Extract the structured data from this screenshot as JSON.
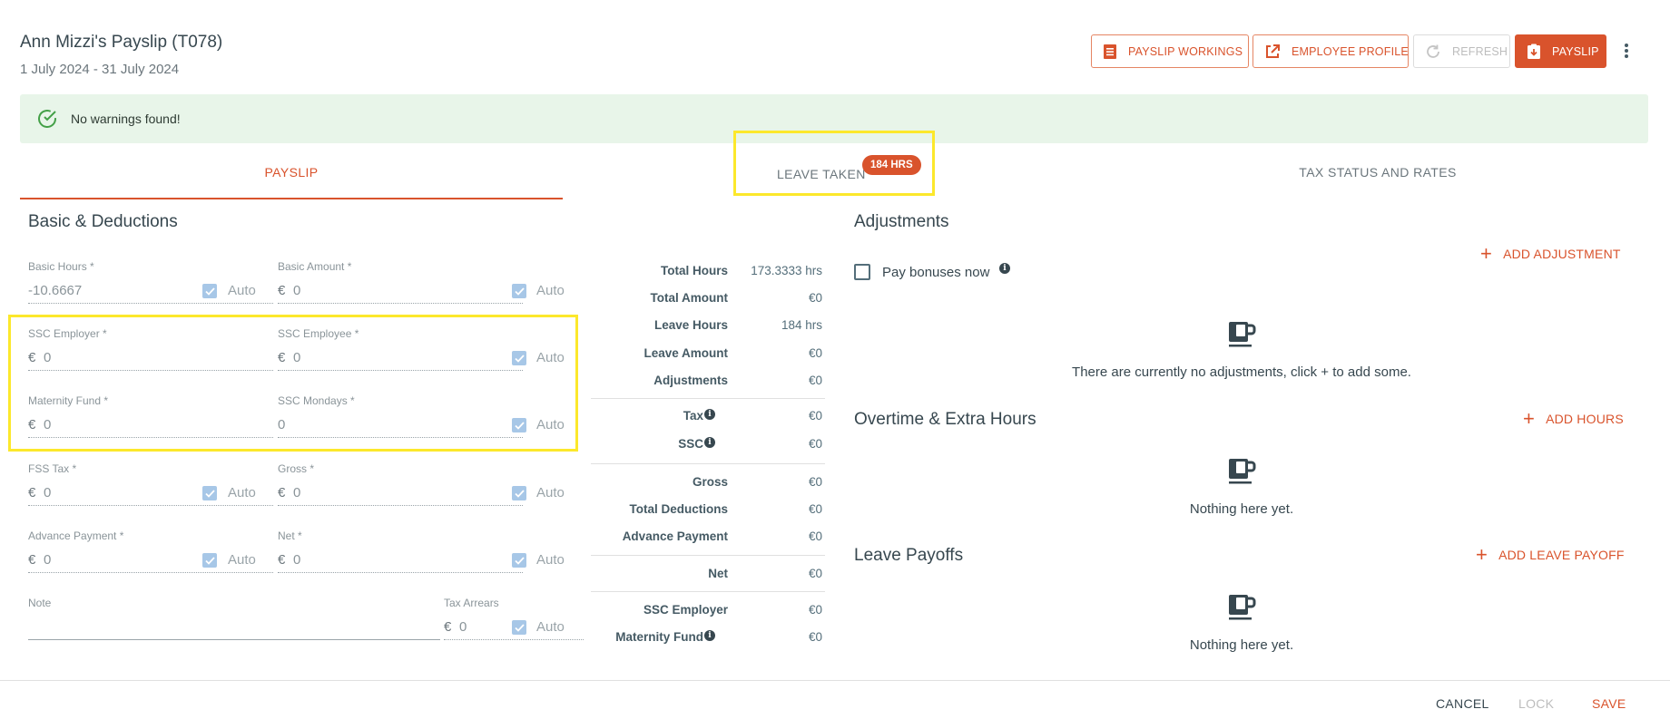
{
  "header": {
    "title": "Ann Mizzi's Payslip (T078)",
    "period": "1 July 2024 - 31 July 2024",
    "buttons": {
      "payslip_workings": "PAYSLIP WORKINGS",
      "employee_profile": "EMPLOYEE PROFILE",
      "refresh": "REFRESH",
      "payslip": "PAYSLIP"
    }
  },
  "alert": {
    "text": "No warnings found!"
  },
  "tabs": {
    "payslip": "PAYSLIP",
    "leave_taken": "LEAVE TAKEN",
    "leave_badge": "184 HRS",
    "tax_status": "TAX STATUS AND RATES"
  },
  "basic": {
    "heading": "Basic & Deductions",
    "auto_label": "Auto",
    "currency": "€",
    "fields": {
      "basic_hours": {
        "label": "Basic Hours *",
        "value": "-10.6667"
      },
      "basic_amount": {
        "label": "Basic Amount *",
        "value": "0"
      },
      "ssc_employer": {
        "label": "SSC Employer *",
        "value": "0"
      },
      "ssc_employee": {
        "label": "SSC Employee *",
        "value": "0"
      },
      "maternity_fund": {
        "label": "Maternity Fund *",
        "value": "0"
      },
      "ssc_mondays": {
        "label": "SSC Mondays *",
        "value": "0"
      },
      "fss_tax": {
        "label": "FSS Tax *",
        "value": "0"
      },
      "gross": {
        "label": "Gross *",
        "value": "0"
      },
      "advance_payment": {
        "label": "Advance Payment *",
        "value": "0"
      },
      "net": {
        "label": "Net *",
        "value": "0"
      },
      "note": {
        "label": "Note",
        "value": ""
      },
      "tax_arrears": {
        "label": "Tax Arrears",
        "value": "0"
      }
    }
  },
  "summary": {
    "total_hours": {
      "label": "Total Hours",
      "value": "173.3333 hrs"
    },
    "total_amount": {
      "label": "Total Amount",
      "value": "€0"
    },
    "leave_hours": {
      "label": "Leave Hours",
      "value": "184 hrs"
    },
    "leave_amount": {
      "label": "Leave Amount",
      "value": "€0"
    },
    "adjustments": {
      "label": "Adjustments",
      "value": "€0"
    },
    "tax": {
      "label": "Tax",
      "value": "€0"
    },
    "ssc": {
      "label": "SSC",
      "value": "€0"
    },
    "gross": {
      "label": "Gross",
      "value": "€0"
    },
    "total_deductions": {
      "label": "Total Deductions",
      "value": "€0"
    },
    "advance_payment": {
      "label": "Advance Payment",
      "value": "€0"
    },
    "net": {
      "label": "Net",
      "value": "€0"
    },
    "ssc_employer": {
      "label": "SSC Employer",
      "value": "€0"
    },
    "maternity_fund": {
      "label": "Maternity Fund",
      "value": "€0"
    }
  },
  "adjustments": {
    "heading": "Adjustments",
    "add_label": "ADD ADJUSTMENT",
    "pay_bonuses_label": "Pay bonuses now",
    "empty_text": "There are currently no adjustments, click + to add some."
  },
  "overtime": {
    "heading": "Overtime & Extra Hours",
    "add_label": "ADD HOURS",
    "empty_text": "Nothing here yet."
  },
  "leave_payoffs": {
    "heading": "Leave Payoffs",
    "add_label": "ADD LEAVE PAYOFF",
    "empty_text": "Nothing here yet."
  },
  "footer": {
    "cancel": "CANCEL",
    "lock": "LOCK",
    "save": "SAVE"
  },
  "colors": {
    "accent": "#d9532c",
    "highlight": "#fce82b",
    "alert_bg": "#e8f5e9",
    "success": "#43a047",
    "checkbox": "#a7c7e7"
  },
  "icons": {
    "payslip_workings": "receipt-icon",
    "employee_profile": "open-external-icon",
    "refresh": "refresh-icon",
    "payslip": "download-document-icon",
    "alert": "check-circle-icon",
    "empty_state": "coffee-cup-icon",
    "add": "plus-icon",
    "info": "info-icon",
    "more": "more-vertical-icon"
  }
}
